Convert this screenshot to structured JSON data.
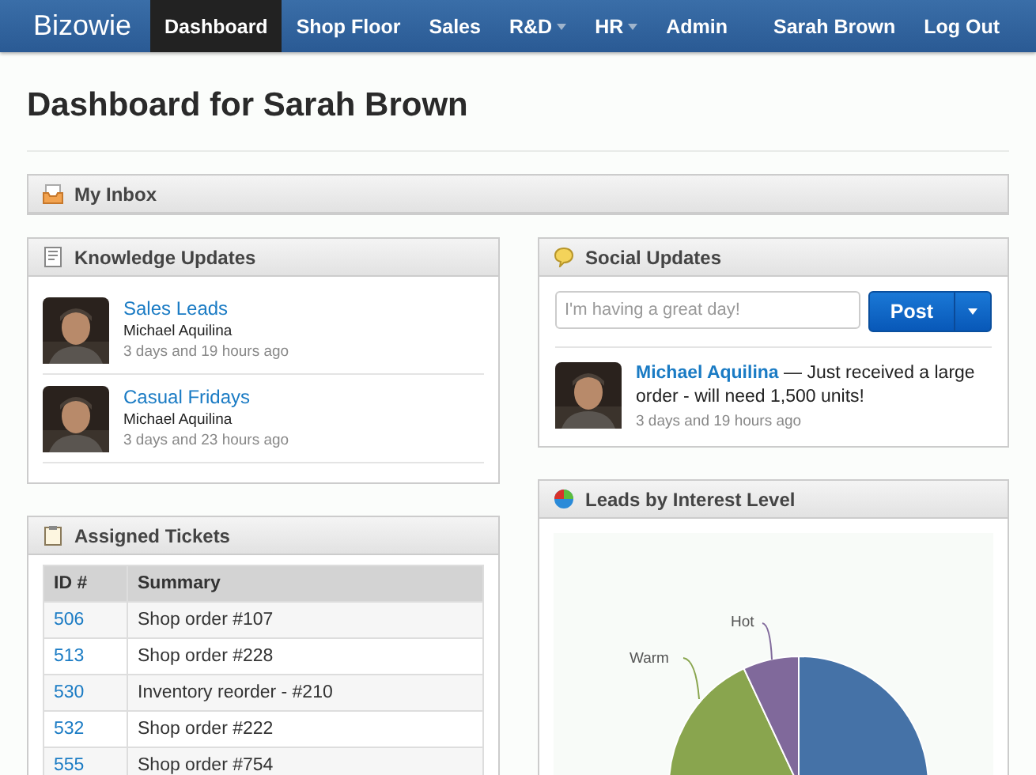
{
  "navbar": {
    "brand": "Bizowie",
    "items": [
      {
        "label": "Dashboard",
        "selected": true,
        "dropdown": false
      },
      {
        "label": "Shop Floor",
        "selected": false,
        "dropdown": false
      },
      {
        "label": "Sales",
        "selected": false,
        "dropdown": false
      },
      {
        "label": "R&D",
        "selected": false,
        "dropdown": true
      },
      {
        "label": "HR",
        "selected": false,
        "dropdown": true
      },
      {
        "label": "Admin",
        "selected": false,
        "dropdown": false
      }
    ],
    "right_items": [
      "Sarah Brown",
      "Log Out"
    ]
  },
  "page_title": "Dashboard for Sarah Brown",
  "inbox": {
    "title": "My Inbox"
  },
  "knowledge_updates": {
    "title": "Knowledge Updates",
    "items": [
      {
        "title": "Sales Leads",
        "author": "Michael Aquilina",
        "time": "3 days and 19 hours ago"
      },
      {
        "title": "Casual Fridays",
        "author": "Michael Aquilina",
        "time": "3 days and 23 hours ago"
      }
    ]
  },
  "social_updates": {
    "title": "Social Updates",
    "input": {
      "placeholder": "I'm having a great day!"
    },
    "post_button": "Post",
    "updates": [
      {
        "author": "Michael Aquilina",
        "text": "— Just received a large order - will need 1,500 units!",
        "time": "3 days and 19 hours ago"
      }
    ]
  },
  "assigned_tickets": {
    "title": "Assigned Tickets",
    "columns": [
      "ID #",
      "Summary"
    ],
    "rows": [
      [
        "506",
        "Shop order #107"
      ],
      [
        "513",
        "Shop order #228"
      ],
      [
        "530",
        "Inventory reorder - #210"
      ],
      [
        "532",
        "Shop order #222"
      ],
      [
        "555",
        "Shop order #754"
      ]
    ]
  },
  "leads_chart": {
    "title": "Leads by Interest Level",
    "slice_labels": [
      "Warm",
      "Hot"
    ]
  }
}
